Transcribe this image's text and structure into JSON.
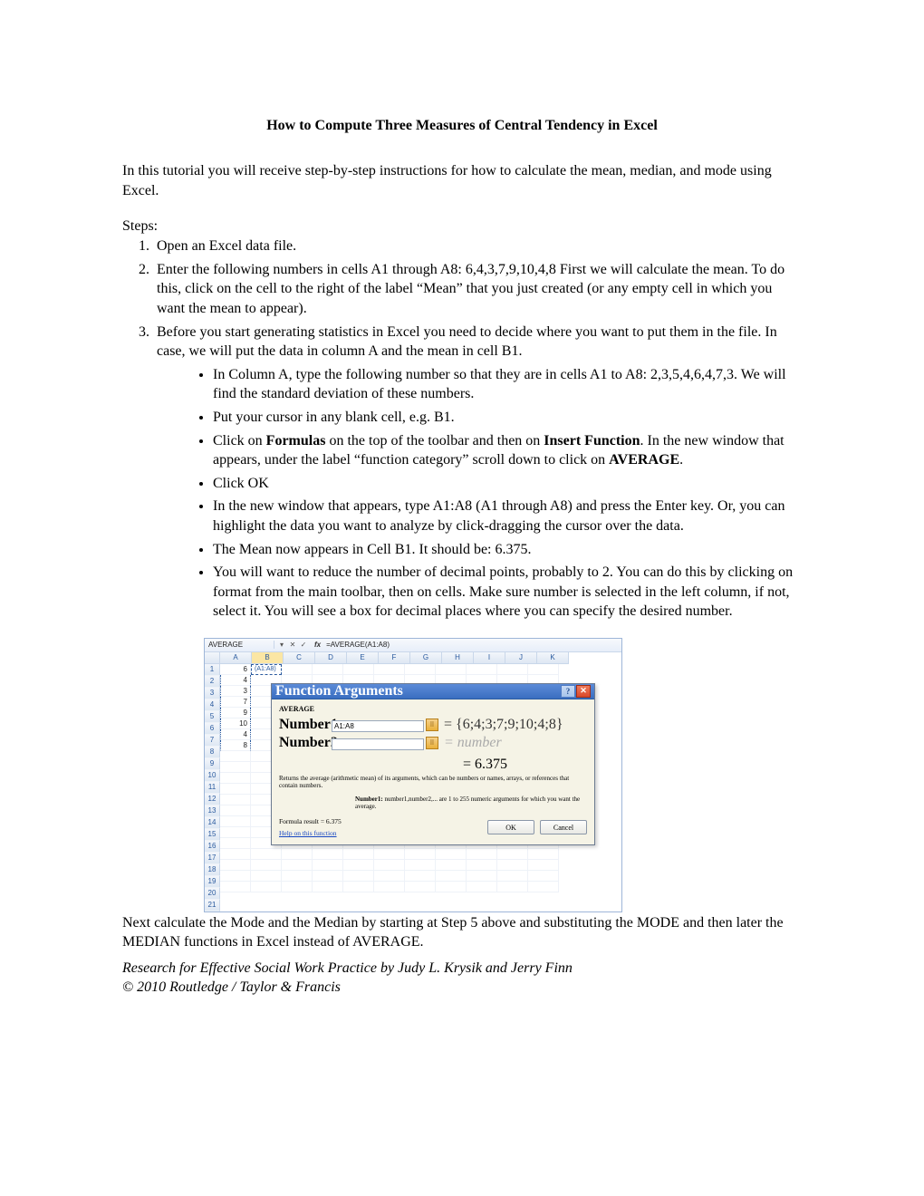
{
  "title": "How to Compute Three Measures of Central Tendency in Excel",
  "intro": "In this tutorial you will receive step-by-step instructions for how to calculate the mean, median, and mode using Excel.",
  "steps_label": "Steps:",
  "steps": {
    "s1": "Open an Excel data file.",
    "s2": "Enter the following numbers in cells A1 through A8: 6,4,3,7,9,10,4,8 First we will calculate the mean. To do this, click on the cell to the right of the label “Mean” that you just created (or any empty cell in which you want the mean to appear).",
    "s3": "Before you start generating statistics in Excel you need to decide where you want to put them in the file. In case, we will put the data in column A and the mean in cell B1."
  },
  "bullets": {
    "b1": "In Column A, type the following number so that they are in cells A1 to A8: 2,3,5,4,6,4,7,3. We will find the standard deviation of these numbers.",
    "b2": "Put your cursor in any blank cell, e.g. B1.",
    "b3a": "Click on ",
    "b3b": "Formulas",
    "b3c": " on the top of the toolbar and then on ",
    "b3d": "Insert Function",
    "b3e": ". In the new window that appears, under the label “function category” scroll down to click on ",
    "b3f": "AVERAGE",
    "b3g": ".",
    "b4": "Click OK",
    "b5": "In the new window that appears, type A1:A8 (A1 through A8) and press the Enter key. Or, you can highlight the data you want to analyze by click-dragging the cursor over the data.",
    "b6": "The Mean now appears in Cell B1. It should be: 6.375.",
    "b7": "You will want to reduce the number of decimal points, probably to 2. You can do this by clicking on format from the main toolbar, then on cells. Make sure number is selected in the left column, if not, select it. You will see a box for decimal places where you can specify the desired number."
  },
  "closing": "Next calculate the Mode and the Median by starting at Step 5 above and substituting the MODE and then later the MEDIAN functions in Excel instead of AVERAGE.",
  "footer1": "Research for Effective Social Work Practice by Judy L. Krysik and Jerry Finn",
  "footer2": "© 2010 Routledge / Taylor & Francis",
  "excel": {
    "namebox": "AVERAGE",
    "fx_label": "fx",
    "formula": "=AVERAGE(A1:A8)",
    "col_headers": [
      "A",
      "B",
      "C",
      "D",
      "E",
      "F",
      "G",
      "H",
      "I",
      "J",
      "K"
    ],
    "row_headers": [
      "1",
      "2",
      "3",
      "4",
      "5",
      "6",
      "7",
      "8",
      "9",
      "10",
      "11",
      "12",
      "13",
      "14",
      "15",
      "16",
      "17",
      "18",
      "19",
      "20",
      "21"
    ],
    "cells_A": [
      "6",
      "4",
      "3",
      "7",
      "9",
      "10",
      "4",
      "8"
    ],
    "cell_B1": "(A1:A8)",
    "dialog": {
      "title": "Function Arguments",
      "func": "AVERAGE",
      "arg1_label": "Number1",
      "arg1_value": "A1:A8",
      "arg1_eval": "= {6;4;3;7;9;10;4;8}",
      "arg2_label": "Number2",
      "arg2_eval": "= number",
      "result_eq": "= 6.375",
      "desc": "Returns the average (arithmetic mean) of its arguments, which can be numbers or names, arrays, or references that contain numbers.",
      "desc2_b": "Number1:",
      "desc2": " number1,number2,... are 1 to 255 numeric arguments for which you want the average.",
      "formula_result": "Formula result = 6.375",
      "help": "Help on this function",
      "ok": "OK",
      "cancel": "Cancel"
    }
  }
}
